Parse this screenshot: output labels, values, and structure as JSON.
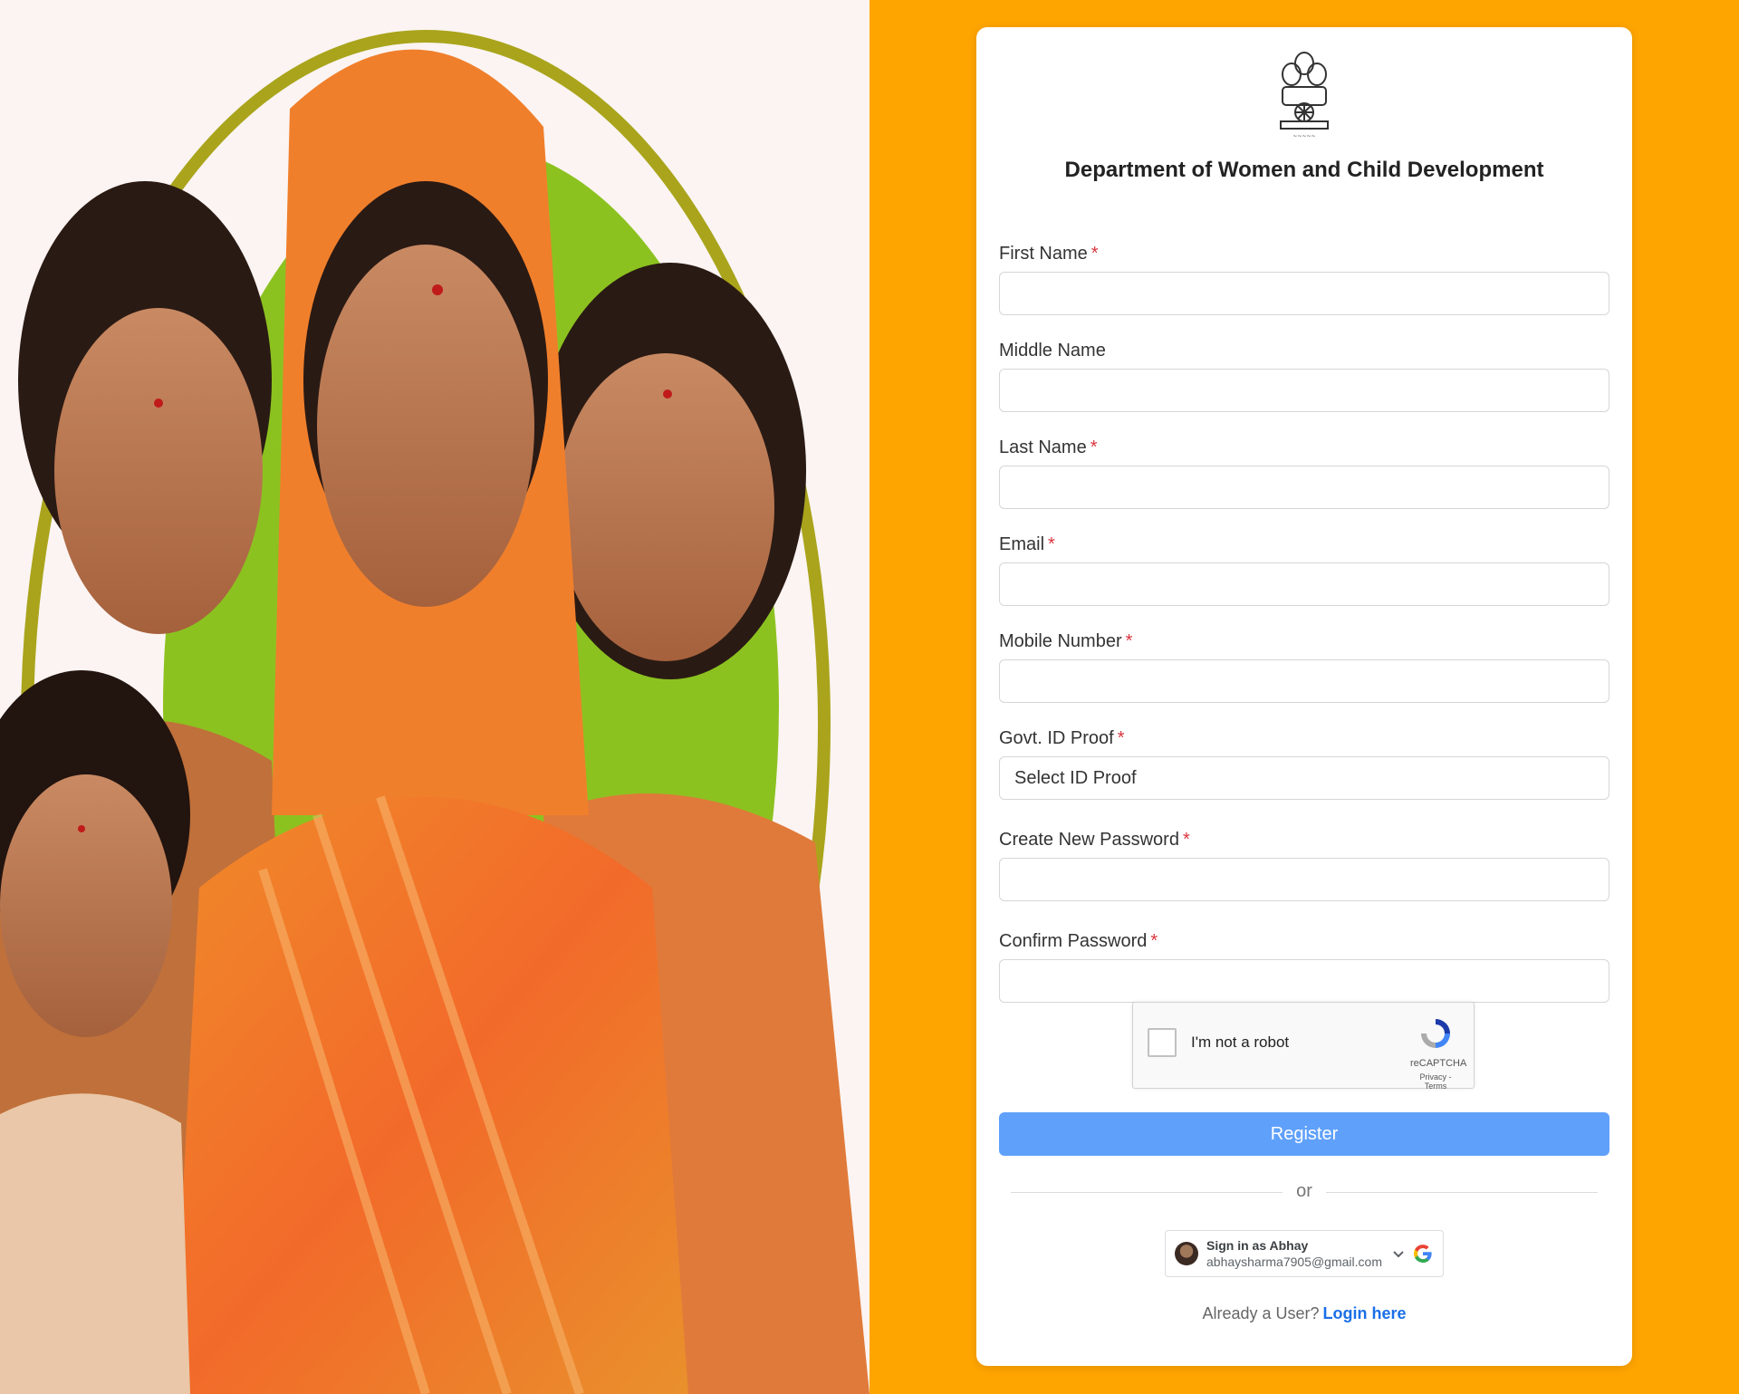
{
  "colors": {
    "background": "#ffa500",
    "primary_button": "#5fa0fa",
    "required": "#d9363e",
    "link": "#1a6fe8"
  },
  "hero": {
    "image": "women-and-children-illustration"
  },
  "panel": {
    "emblem_icon": "state-emblem-icon",
    "title": "Department of Women and Child Development"
  },
  "fields": {
    "first_name": {
      "label": "First Name",
      "required": "*",
      "value": ""
    },
    "middle_name": {
      "label": "Middle Name",
      "value": ""
    },
    "last_name": {
      "label": "Last Name",
      "required": "*",
      "value": ""
    },
    "email": {
      "label": "Email",
      "required": "*",
      "value": ""
    },
    "mobile": {
      "label": "Mobile Number",
      "required": "*",
      "value": ""
    },
    "govt_id": {
      "label": "Govt. ID Proof",
      "required": "*",
      "selected": "Select ID Proof"
    },
    "new_password": {
      "label": "Create New Password",
      "required": "*",
      "value": ""
    },
    "confirm_password": {
      "label": "Confirm Password",
      "required": "*",
      "value": ""
    }
  },
  "captcha": {
    "label": "I'm not a robot",
    "brand": "reCAPTCHA",
    "privacy": "Privacy",
    "sep": " - ",
    "terms": "Terms"
  },
  "register_label": "Register",
  "divider_text": "or",
  "google": {
    "name": "Sign in as Abhay",
    "email": "abhaysharma7905@gmail.com"
  },
  "login": {
    "prompt": "Already a User?",
    "link": "Login here"
  }
}
